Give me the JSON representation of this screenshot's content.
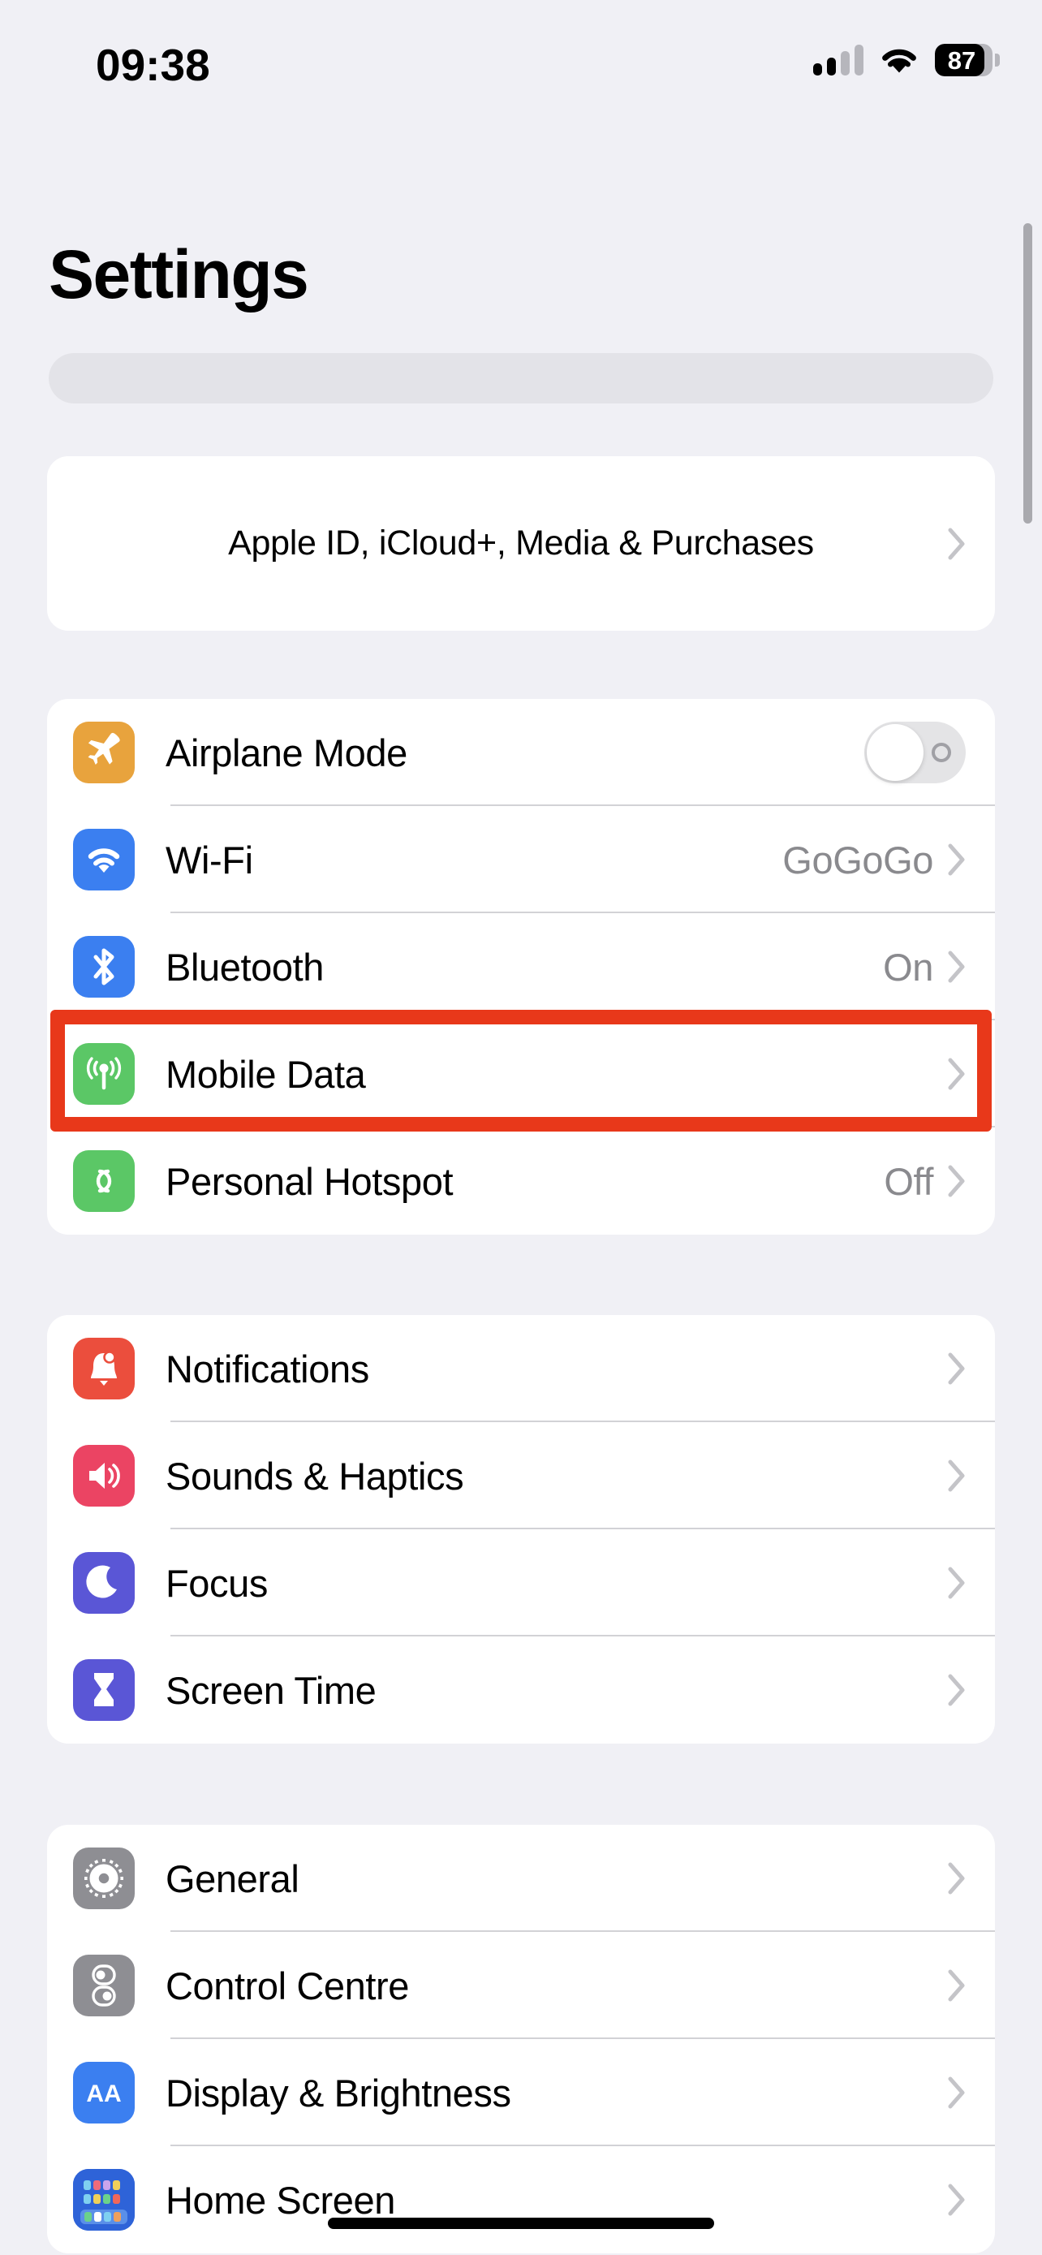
{
  "status_bar": {
    "time": "09:38",
    "battery_percent": "87",
    "signal_icon": "cellular-signal-icon",
    "wifi_icon": "wifi-icon",
    "battery_icon": "battery-icon"
  },
  "header": {
    "title": "Settings",
    "search_placeholder": ""
  },
  "apple_id": {
    "label": "Apple ID, iCloud+, Media & Purchases"
  },
  "groups": [
    {
      "id": "connectivity",
      "rows": [
        {
          "label": "Airplane Mode",
          "value": "",
          "icon": "airplane-icon",
          "icon_color": "#E8A33D",
          "control": "toggle",
          "toggle_on": false
        },
        {
          "label": "Wi-Fi",
          "value": "GoGoGo",
          "icon": "wifi-icon",
          "icon_color": "#3B7FF0",
          "control": "chevron"
        },
        {
          "label": "Bluetooth",
          "value": "On",
          "icon": "bluetooth-icon",
          "icon_color": "#3B7FF0",
          "control": "chevron"
        },
        {
          "label": "Mobile Data",
          "value": "",
          "icon": "antenna-icon",
          "icon_color": "#5BC766",
          "control": "chevron",
          "highlighted": true
        },
        {
          "label": "Personal Hotspot",
          "value": "Off",
          "icon": "hotspot-links-icon",
          "icon_color": "#5BC766",
          "control": "chevron"
        }
      ]
    },
    {
      "id": "alerts",
      "rows": [
        {
          "label": "Notifications",
          "value": "",
          "icon": "bell-icon",
          "icon_color": "#EB4E3D",
          "control": "chevron"
        },
        {
          "label": "Sounds & Haptics",
          "value": "",
          "icon": "speaker-icon",
          "icon_color": "#EB4463",
          "control": "chevron"
        },
        {
          "label": "Focus",
          "value": "",
          "icon": "moon-icon",
          "icon_color": "#5A56D6",
          "control": "chevron"
        },
        {
          "label": "Screen Time",
          "value": "",
          "icon": "hourglass-icon",
          "icon_color": "#5A56D6",
          "control": "chevron"
        }
      ]
    },
    {
      "id": "system",
      "rows": [
        {
          "label": "General",
          "value": "",
          "icon": "gear-icon",
          "icon_color": "#8E8E93",
          "control": "chevron"
        },
        {
          "label": "Control Centre",
          "value": "",
          "icon": "control-centre-icon",
          "icon_color": "#8E8E93",
          "control": "chevron"
        },
        {
          "label": "Display & Brightness",
          "value": "",
          "icon": "display-aa-icon",
          "icon_color": "#3B7FF0",
          "control": "chevron"
        },
        {
          "label": "Home Screen",
          "value": "",
          "icon": "home-screen-grid-icon",
          "icon_color": "#2E63D8",
          "control": "chevron"
        }
      ]
    }
  ],
  "annotation": {
    "target_label": "Mobile Data",
    "color": "#E8381A"
  },
  "colors": {
    "page_background": "#F0F0F5",
    "card_background": "#FFFFFF",
    "secondary_text": "#8A8A8E",
    "separator": "#D2D2D6",
    "search_field": "#E3E3E8",
    "scroll_indicator": "#A9A9AE"
  }
}
